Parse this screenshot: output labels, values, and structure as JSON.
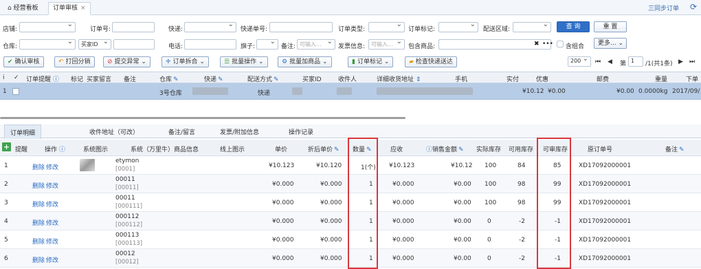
{
  "tabs": {
    "dashboard": "经营看板",
    "review": "订单审核",
    "close": "×"
  },
  "top_right": {
    "sync": "三同步订单",
    "refresh": "⟳"
  },
  "filters": {
    "shop": "店铺:",
    "order_no": "订单号:",
    "express": "快递:",
    "express_no": "快递单号:",
    "order_type": "订单类型:",
    "order_tag": "订单标记:",
    "delivery_area": "配送区域:",
    "search": "查 询",
    "reset": "重 置",
    "warehouse": "仓库:",
    "buyer_id_select": "买家ID",
    "phone": "电话:",
    "flag": "旗子:",
    "remark": "备注:",
    "remark_ph": "可输入...",
    "invoice": "发票信息:",
    "invoice_ph": "可输入...",
    "contains_goods": "包含商品:",
    "contains_clear": "✖",
    "contains_more": "•••",
    "combo": "含组合",
    "more": "更多..."
  },
  "toolbar": {
    "confirm": "确认审核",
    "print": "打回分销",
    "submit_abn": "提交异常",
    "split": "订单拆合",
    "batch": "批量操作",
    "add_goods": "批量加商品",
    "tag": "订单标记",
    "check_express": "检查快递送达"
  },
  "pager": {
    "size": "200",
    "first": "⏮",
    "prev": "◀",
    "page_label": "第",
    "page": "1",
    "total": "/1(共1条)",
    "next": "▶",
    "last": "⏭"
  },
  "grid_headers": [
    "i",
    "✓",
    "订单提醒",
    "标记",
    "买家留言",
    "备注",
    "仓库",
    "快递",
    "配送方式",
    "买家ID",
    "收件人",
    "详细收货地址",
    "手机",
    "实付",
    "优惠",
    "邮费",
    "重量",
    "下单"
  ],
  "grid_row": {
    "num": "1",
    "warehouse": "3号仓库",
    "delivery": "快递",
    "paid": "¥10.12",
    "discount": "¥0.00",
    "postage": "¥0.00",
    "weight": "0.0000kg",
    "date": "2017/09/"
  },
  "detail_tabs": [
    "订单明细",
    "收件地址（可改）",
    "备注/留言",
    "发票/附加信息",
    "操作记录"
  ],
  "detail_headers": {
    "remind": "提醒",
    "op": "操作",
    "sys_img": "系统图示",
    "sys_goods": "系统（万里牛）商品信息",
    "online_img": "线上图示",
    "unit_price": "单价",
    "discount_price": "折后单价",
    "qty": "数量",
    "receivable": "应收",
    "sales_amount": "销售金额",
    "actual_stock": "实际库存",
    "avail_stock": "可用库存",
    "review_stock": "可审库存",
    "orig_order": "原订单号",
    "remark": "备注"
  },
  "detail_rows": [
    {
      "n": "1",
      "del": "删除",
      "edit": "修改",
      "code": "etymon",
      "sub": "[0001]",
      "unit": "¥10.123",
      "disc": "¥10.120",
      "qty": "1(个)",
      "recv": "¥10.123",
      "sales": "¥10.12",
      "actual": "100",
      "avail": "84",
      "review": "85",
      "orig": "XD17092000001"
    },
    {
      "n": "2",
      "del": "删除",
      "edit": "修改",
      "code": "00011",
      "sub": "[00011]",
      "unit": "¥0.000",
      "disc": "¥0.000",
      "qty": "1",
      "recv": "¥0.000",
      "sales": "¥0.00",
      "actual": "100",
      "avail": "98",
      "review": "99",
      "orig": "XD17092000001"
    },
    {
      "n": "3",
      "del": "删除",
      "edit": "修改",
      "code": "00011",
      "sub": "[000111]",
      "unit": "¥0.000",
      "disc": "¥0.000",
      "qty": "1",
      "recv": "¥0.000",
      "sales": "¥0.00",
      "actual": "100",
      "avail": "98",
      "review": "99",
      "orig": "XD17092000001"
    },
    {
      "n": "4",
      "del": "删除",
      "edit": "修改",
      "code": "000112",
      "sub": "[000112]",
      "unit": "¥0.000",
      "disc": "¥0.000",
      "qty": "1",
      "recv": "¥0.000",
      "sales": "¥0.00",
      "actual": "0",
      "avail": "-2",
      "review": "-1",
      "orig": "XD17092000001"
    },
    {
      "n": "5",
      "del": "删除",
      "edit": "修改",
      "code": "000113",
      "sub": "[000113]",
      "unit": "¥0.000",
      "disc": "¥0.000",
      "qty": "1",
      "recv": "¥0.000",
      "sales": "¥0.00",
      "actual": "0",
      "avail": "-2",
      "review": "-1",
      "orig": "XD17092000001"
    },
    {
      "n": "6",
      "del": "删除",
      "edit": "修改",
      "code": "00012",
      "sub": "[00012]",
      "unit": "¥0.000",
      "disc": "¥0.000",
      "qty": "1",
      "recv": "¥0.000",
      "sales": "¥0.00",
      "actual": "0",
      "avail": "-2",
      "review": "-1",
      "orig": "XD17092000001"
    }
  ],
  "colors": {
    "accent": "#2f6fc7",
    "highlight_box": "#d9363e",
    "selected_row": "#b7cce6"
  }
}
